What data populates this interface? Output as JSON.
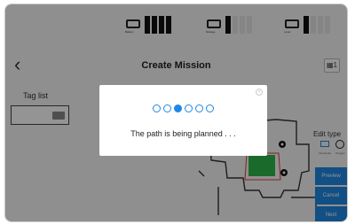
{
  "status_bar": {
    "battery": {
      "label": "Battery",
      "filled": 4,
      "total": 4,
      "color": "#111111"
    },
    "storage": {
      "label": "Storage",
      "filled": 1,
      "total": 4,
      "color": "#111111"
    },
    "level": {
      "label": "Level",
      "filled": 1,
      "total": 4,
      "color": "#111111"
    }
  },
  "header": {
    "title": "Create Mission",
    "map_badge": "1"
  },
  "left_panel": {
    "tag_list_label": "Tag list"
  },
  "right_panel": {
    "edit_type_label": "Edit type",
    "rect_label": "Rectangle",
    "poly_label": "Polygon",
    "preview_label": "Preview",
    "cancel_label": "Cancel",
    "next_label": "Next"
  },
  "dialog": {
    "message": "The path is being planned . . .",
    "progress": {
      "total": 6,
      "active_index": 2
    }
  },
  "colors": {
    "accent": "#1e88e5",
    "zone": "#2eb84a",
    "overlay": "rgba(0,0,0,0.42)"
  }
}
